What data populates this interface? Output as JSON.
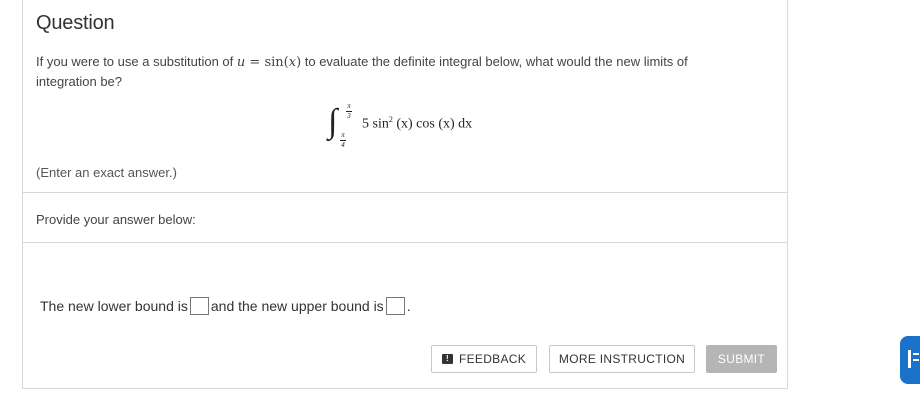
{
  "question": {
    "title": "Question",
    "text_before": "If you were to use a substitution of ",
    "substitution_u": "u",
    "substitution_eq": " = ",
    "substitution_func": "sin(",
    "substitution_x": "x",
    "substitution_close": ")",
    "text_after": " to evaluate the definite integral below, what would the new limits of integration be?",
    "integral": {
      "upper_num": "π",
      "upper_den": "3",
      "lower_num": "π",
      "lower_den": "4",
      "integrand": "5 sin",
      "power": "2",
      "rest": " (x) cos (x) dx"
    },
    "note": "(Enter an exact answer.)"
  },
  "answer": {
    "provide_label": "Provide your answer below:",
    "lower_label": "The new lower bound is",
    "upper_label": "and the new upper bound is",
    "period": ".",
    "lower_value": "",
    "upper_value": ""
  },
  "buttons": {
    "feedback": "FEEDBACK",
    "more_instruction": "MORE INSTRUCTION",
    "submit": "SUBMIT"
  },
  "icons": {
    "feedback": "feedback-icon",
    "side_tab": "help-tab-icon"
  },
  "colors": {
    "submit_bg": "#b5b5b5",
    "side_tab": "#1a73c8"
  }
}
